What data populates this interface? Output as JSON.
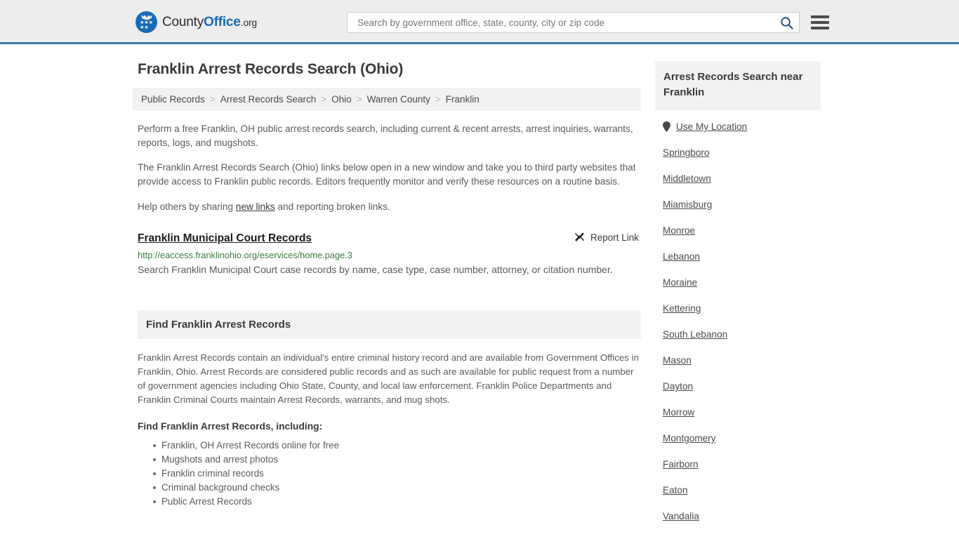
{
  "header": {
    "logo": {
      "part1": "County",
      "part2": "Office",
      "part3": ".org",
      "icon": "eagle-shield-logo"
    },
    "search": {
      "placeholder": "Search by government office, state, county, city or zip code",
      "value": "",
      "icon": "search-icon"
    },
    "menu_icon": "hamburger-menu-icon",
    "accent_color": "#3d74a8"
  },
  "main": {
    "title": "Franklin Arrest Records Search (Ohio)",
    "breadcrumb": [
      "Public Records",
      "Arrest Records Search",
      "Ohio",
      "Warren County",
      "Franklin"
    ],
    "breadcrumb_separator": ">",
    "intro": [
      "Perform a free Franklin, OH public arrest records search, including current & recent arrests, arrest inquiries, warrants, reports, logs, and mugshots.",
      "The Franklin Arrest Records Search (Ohio) links below open in a new window and take you to third party websites that provide access to Franklin public records. Editors frequently monitor and verify these resources on a routine basis."
    ],
    "help_line": {
      "before": "Help others by sharing ",
      "link": "new links",
      "after": " and reporting broken links."
    },
    "result": {
      "title": "Franklin Municipal Court Records",
      "url": "http://eaccess.franklinohio.org/eservices/home.page.3",
      "description": "Search Franklin Municipal Court case records by name, case type, case number, attorney, or citation number.",
      "report_label": "Report Link",
      "report_icon": "broken-link-icon",
      "url_color": "#3a7d3a"
    },
    "section": {
      "heading": "Find Franklin Arrest Records",
      "body": "Franklin Arrest Records contain an individual's entire criminal history record and are available from Government Offices in Franklin, Ohio. Arrest Records are considered public records and as such are available for public request from a number of government agencies including Ohio State, County, and local law enforcement. Franklin Police Departments and Franklin Criminal Courts maintain Arrest Records, warrants, and mug shots.",
      "subheading": "Find Franklin Arrest Records, including:",
      "bullets": [
        "Franklin, OH Arrest Records online for free",
        "Mugshots and arrest photos",
        "Franklin criminal records",
        "Criminal background checks",
        "Public Arrest Records"
      ]
    }
  },
  "sidebar": {
    "heading": "Arrest Records Search near Franklin",
    "use_my_location": {
      "label": "Use My Location",
      "icon": "map-pin-icon"
    },
    "cities": [
      "Springboro",
      "Middletown",
      "Miamisburg",
      "Monroe",
      "Lebanon",
      "Moraine",
      "Kettering",
      "South Lebanon",
      "Mason",
      "Dayton",
      "Morrow",
      "Montgomery",
      "Fairborn",
      "Eaton",
      "Vandalia"
    ]
  }
}
